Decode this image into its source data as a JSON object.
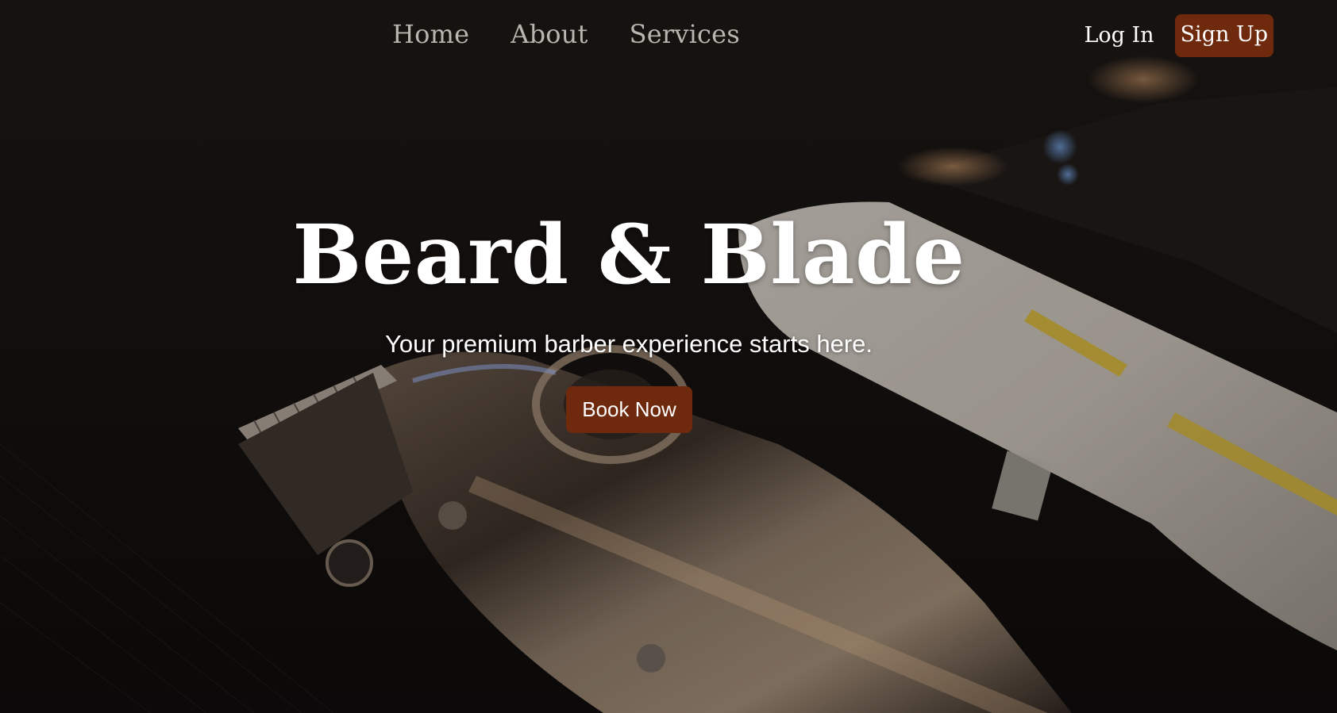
{
  "nav": {
    "links": [
      {
        "label": "Home"
      },
      {
        "label": "About"
      },
      {
        "label": "Services"
      }
    ],
    "login_label": "Log In",
    "signup_label": "Sign Up"
  },
  "hero": {
    "title": "Beard & Blade",
    "subtitle": "Your premium barber experience starts here.",
    "cta_label": "Book Now"
  },
  "colors": {
    "accent": "#6f2a0e",
    "nav_link": "#b9b5b0",
    "text": "#ffffff",
    "background": "#0f0c0a"
  },
  "icons": {
    "hero_background": "barber-clippers-photo"
  }
}
